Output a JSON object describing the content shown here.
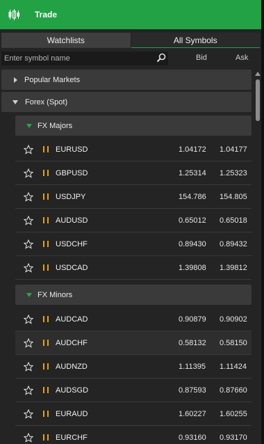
{
  "header": {
    "title": "Trade",
    "icon": "candlestick-chart-icon",
    "color": "#22a244"
  },
  "tabs": [
    {
      "label": "Watchlists",
      "active": false
    },
    {
      "label": "All Symbols",
      "active": true
    }
  ],
  "search": {
    "placeholder": "Enter symbol name",
    "value": ""
  },
  "columns": {
    "bid": "Bid",
    "ask": "Ask"
  },
  "groups": [
    {
      "label": "Popular Markets",
      "expanded": false
    },
    {
      "label": "Forex (Spot)",
      "expanded": true
    }
  ],
  "subgroups": [
    {
      "label": "FX Majors"
    },
    {
      "label": "FX Minors"
    }
  ],
  "majors": [
    {
      "symbol": "EURUSD",
      "bid": "1.04172",
      "ask": "1.04177"
    },
    {
      "symbol": "GBPUSD",
      "bid": "1.25314",
      "ask": "1.25323"
    },
    {
      "symbol": "USDJPY",
      "bid": "154.786",
      "ask": "154.805"
    },
    {
      "symbol": "AUDUSD",
      "bid": "0.65012",
      "ask": "0.65018"
    },
    {
      "symbol": "USDCHF",
      "bid": "0.89430",
      "ask": "0.89432"
    },
    {
      "symbol": "USDCAD",
      "bid": "1.39808",
      "ask": "1.39812"
    }
  ],
  "minors": [
    {
      "symbol": "AUDCAD",
      "bid": "0.90879",
      "ask": "0.90902"
    },
    {
      "symbol": "AUDCHF",
      "bid": "0.58132",
      "ask": "0.58150"
    },
    {
      "symbol": "AUDNZD",
      "bid": "1.11395",
      "ask": "1.11424"
    },
    {
      "symbol": "AUDSGD",
      "bid": "0.87593",
      "ask": "0.87660"
    },
    {
      "symbol": "EURAUD",
      "bid": "1.60227",
      "ask": "1.60255"
    },
    {
      "symbol": "EURCHF",
      "bid": "0.93160",
      "ask": "0.93170"
    }
  ]
}
